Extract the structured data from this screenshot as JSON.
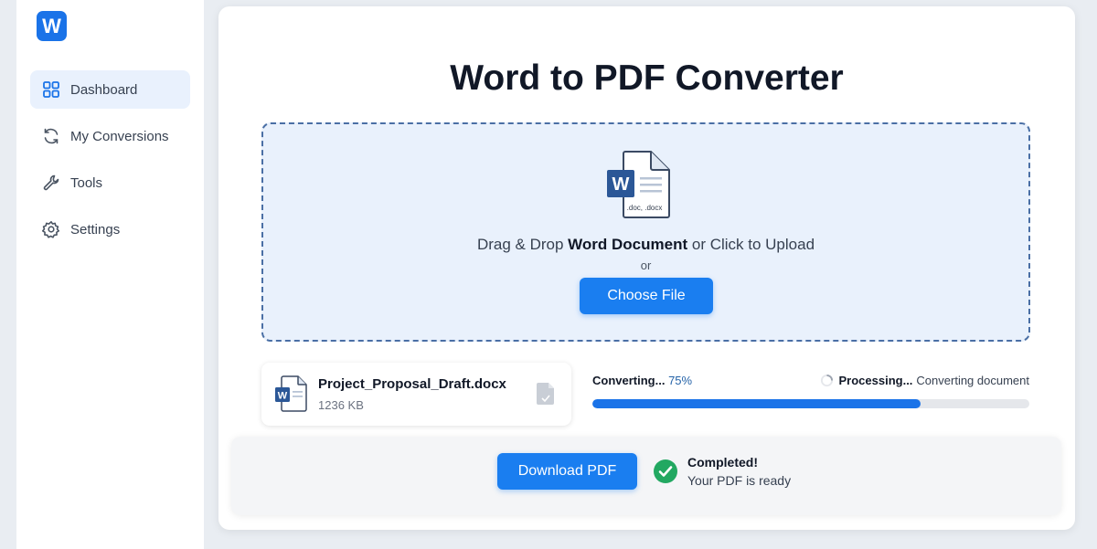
{
  "app": {
    "logo_letter": "W",
    "accent": "#1a73e8"
  },
  "sidebar": {
    "items": [
      {
        "label": "Dashboard",
        "icon": "grid-icon",
        "active": true
      },
      {
        "label": "My Conversions",
        "icon": "refresh-icon",
        "active": false
      },
      {
        "label": "Tools",
        "icon": "wrench-icon",
        "active": false
      },
      {
        "label": "Settings",
        "icon": "gear-icon",
        "active": false
      }
    ]
  },
  "main": {
    "title": "Word to PDF Converter",
    "dropzone": {
      "icon_letter": "W",
      "icon_caption": ".doc, .docx",
      "text_before": "Drag & Drop ",
      "text_bold": "Word Document",
      "text_after": " or Click to Upload",
      "or": "or",
      "choose_button": "Choose File"
    },
    "file": {
      "icon_letter": "W",
      "name": "Project_Proposal_Draft.docx",
      "size": "1236 KB"
    },
    "progress": {
      "label": "Converting...",
      "percent_text": "75%",
      "fraction": 0.75,
      "status_bold": "Processing...",
      "status_text": "Converting document"
    },
    "result": {
      "download_button": "Download PDF",
      "status_title": "Completed!",
      "status_sub": "Your PDF is ready",
      "status_color": "#22a861"
    }
  }
}
